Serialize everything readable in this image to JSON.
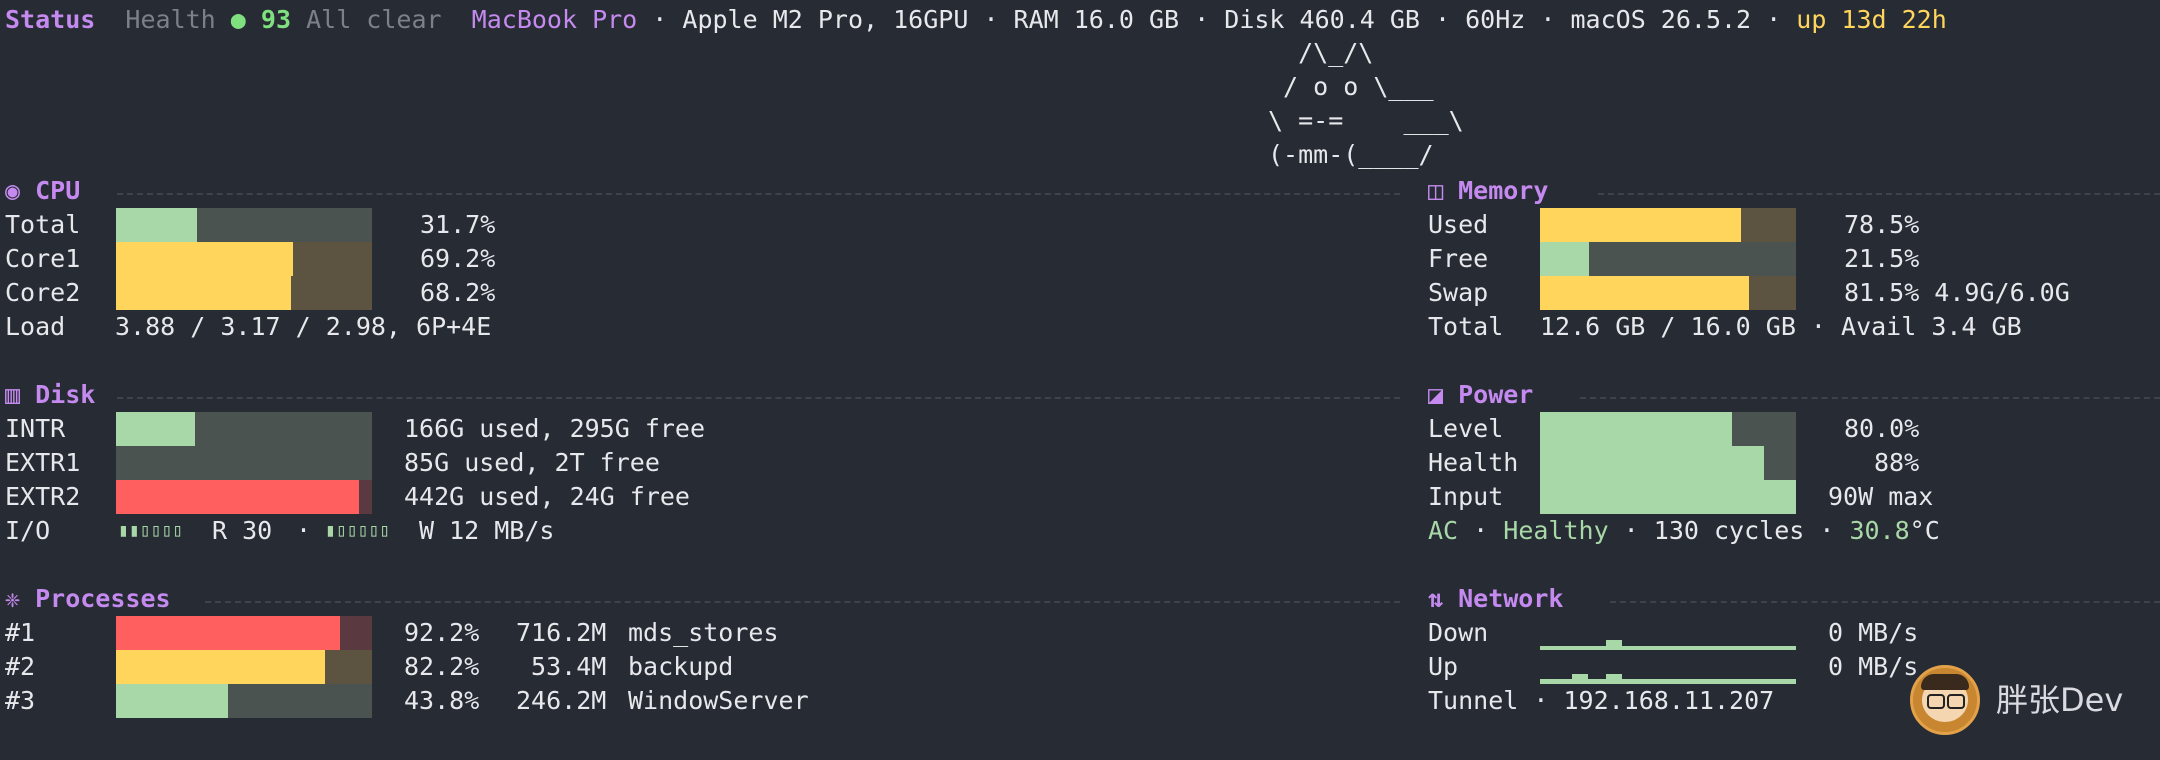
{
  "header": {
    "status": "Status",
    "health_label": "Health",
    "health_dot": "●",
    "health_score": "93",
    "health_text": "All clear",
    "model": "MacBook Pro",
    "sep1": " · ",
    "chip": "Apple M2 Pro, 16GPU",
    "sep2": " · ",
    "ram": "RAM 16.0 GB",
    "sep3": " · ",
    "disk": "Disk 460.4 GB",
    "sep4": " · ",
    "refresh": "60Hz",
    "sep5": " · ",
    "os": "macOS 26.5.2",
    "sep6": " · ",
    "uptime": "up 13d 22h"
  },
  "mascot": {
    "line1": "  /\\_/\\",
    "line2": " / o o \\___",
    "line3": "\\ =-=    ___\\",
    "line4": "(-mm-(____/"
  },
  "cpu": {
    "title": "◉ CPU",
    "rows": [
      {
        "label": "Total",
        "value": "31.7%",
        "fraction": 0.317,
        "color": "#a8d8a8"
      },
      {
        "label": "Core1",
        "value": "69.2%",
        "fraction": 0.692,
        "color": "#ffd55c"
      },
      {
        "label": "Core2",
        "value": "68.2%",
        "fraction": 0.682,
        "color": "#ffd55c"
      }
    ],
    "load_label": "Load",
    "load_value": "3.88 / 3.17 / 2.98, 6P+4E"
  },
  "memory": {
    "title": "◫ Memory",
    "rows": [
      {
        "label": "Used",
        "value": "78.5%",
        "fraction": 0.785,
        "color": "#ffd55c"
      },
      {
        "label": "Free",
        "value": "21.5%",
        "fraction": 0.19,
        "color": "#a8d8a8"
      },
      {
        "label": "Swap",
        "value": "81.5% 4.9G/6.0G",
        "fraction": 0.815,
        "color": "#ffd55c"
      }
    ],
    "total_label": "Total",
    "total_value": "12.6 GB / 16.0 GB · Avail 3.4 GB"
  },
  "disk": {
    "title": "▥ Disk",
    "rows": [
      {
        "label": "INTR",
        "value": "166G used, 295G free",
        "fraction": 0.31,
        "color": "#a8d8a8"
      },
      {
        "label": "EXTR1",
        "value": "85G used, 2T free",
        "fraction": 0.0,
        "color": "#a8d8a8"
      },
      {
        "label": "EXTR2",
        "value": "442G used, 24G free",
        "fraction": 0.95,
        "color": "#ff5f5f"
      }
    ],
    "io_label": "I/O",
    "io_read_blocks": "▮▮▯▯▯▯",
    "io_read": "R 30",
    "io_sep": "·",
    "io_write_blocks": "▮▯▯▯▯▯",
    "io_write": "W 12 MB/s"
  },
  "power": {
    "title": "◪ Power",
    "rows": [
      {
        "label": "Level",
        "value": "80.0%",
        "fraction": 0.75,
        "color": "#a8d8a8"
      },
      {
        "label": "Health",
        "value": "88%",
        "fraction": 0.875,
        "color": "#a8d8a8"
      },
      {
        "label": "Input",
        "value": "90W max",
        "fraction": 1.0,
        "color": "#a8d8a8"
      }
    ],
    "ac": "AC",
    "sep1": " · ",
    "health_status": "Healthy",
    "sep2": " · ",
    "cycles": "130 cycles",
    "sep3": " · ",
    "temp_value": "30.8",
    "temp_unit": "°C"
  },
  "processes": {
    "title": "❈ Processes",
    "rows": [
      {
        "rank": "#1",
        "percent": "92.2%",
        "mem": "716.2M",
        "name": "mds_stores",
        "fraction": 0.875,
        "color": "#ff5f5f"
      },
      {
        "rank": "#2",
        "percent": "82.2%",
        "mem": " 53.4M",
        "name": "backupd",
        "fraction": 0.815,
        "color": "#ffd55c"
      },
      {
        "rank": "#3",
        "percent": "43.8%",
        "mem": "246.2M",
        "name": "WindowServer",
        "fraction": 0.438,
        "color": "#a8d8a8"
      }
    ]
  },
  "network": {
    "title": "⇅ Network",
    "down_label": "Down",
    "down_value": "0 MB/s",
    "up_label": "Up",
    "up_value": "0 MB/s",
    "tunnel_label": "Tunnel",
    "tunnel_sep": " · ",
    "tunnel_ip": "192.168.11.207"
  },
  "brand": {
    "text": "胖张Dev"
  },
  "colors": {
    "green": "#a8d8a8",
    "yellow": "#ffd55c",
    "red": "#ff5f5f",
    "purple": "#c58af0",
    "track": "#4b5350"
  }
}
